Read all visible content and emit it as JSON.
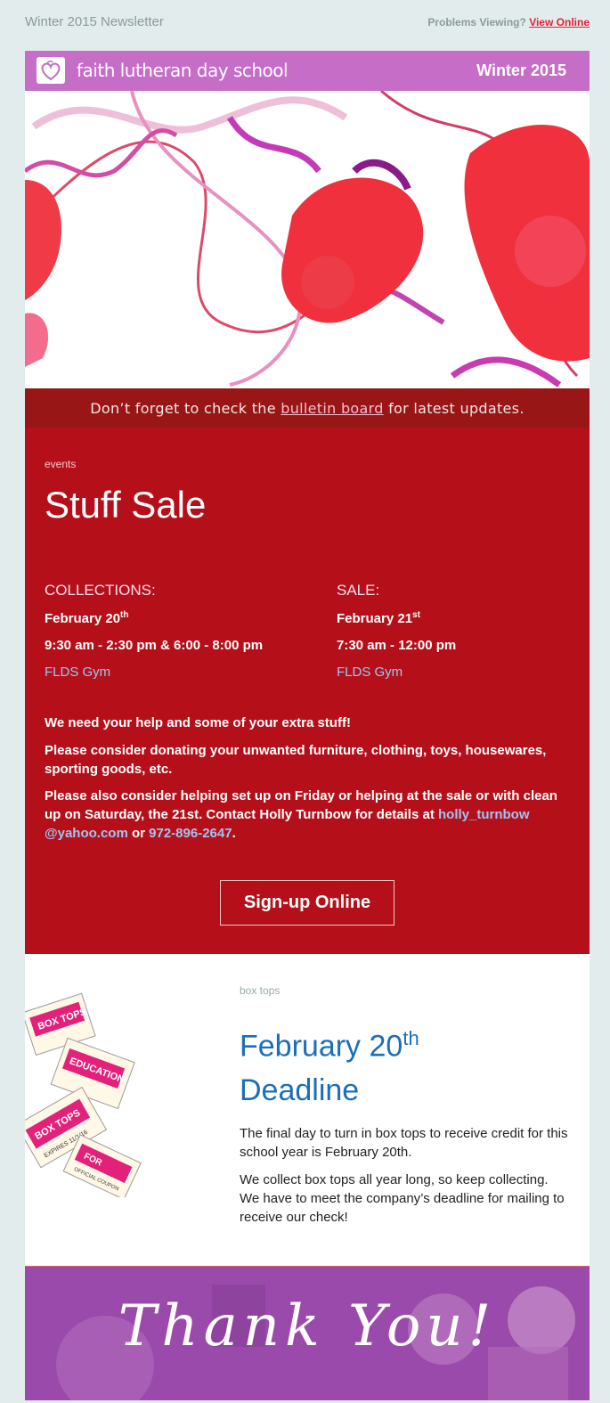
{
  "top": {
    "newsletter_label": "Winter 2015 Newsletter",
    "problems_label": "Problems Viewing?",
    "view_online_label": "View Online"
  },
  "header": {
    "school_name": "faith lutheran day school",
    "season": "Winter 2015",
    "logo_icon": "heart-logo-icon",
    "bg_color": "#c56dc7"
  },
  "notice": {
    "pre": "Don’t forget to check the",
    "link": "bulletin board",
    "post": "for latest updates."
  },
  "events": {
    "eyebrow": "events",
    "title": "Stuff Sale",
    "collections": {
      "heading": "COLLECTIONS:",
      "date": "February 20",
      "date_sup": "th",
      "time": "9:30 am - 2:30 pm & 6:00 - 8:00 pm",
      "location": "FLDS Gym"
    },
    "sale": {
      "heading": "SALE:",
      "date": "February 21",
      "date_sup": "st",
      "time": "7:30 am - 12:00 pm",
      "location": "FLDS Gym"
    },
    "p1": "We need your help and some of your extra stuff!",
    "p2": "Please consider donating your unwanted furniture, clothing, toys, housewares, sporting goods, etc.",
    "p3_pre": "Please also consider helping set up on Friday or helping at the sale or with clean up on Saturday, the 21st. Contact Holly Turnbow for details at",
    "email": "holly_turnbow @yahoo.com",
    "p3_or": "or",
    "phone": "972-896-2647",
    "p3_end": ".",
    "signup_label": "Sign-up Online",
    "bg_color": "#b5101a"
  },
  "boxtops": {
    "eyebrow": "box tops",
    "title_line1": "February 20",
    "title_sup": "th",
    "title_line2": "Deadline",
    "p1": "The final day to turn in box tops to receive credit for this school year is February 20th.",
    "p2": "We collect box tops all year long, so keep collecting. We have to meet the company’s deadline for mailing to receive our check!",
    "coupon_text": [
      "BOX TOPS",
      "FOR",
      "EDUCATION",
      "EXPIRES 11/1/16",
      "OFFICIAL COUPON"
    ],
    "title_color": "#1a6fb8"
  },
  "thanks": {
    "message": "Thank You!"
  }
}
